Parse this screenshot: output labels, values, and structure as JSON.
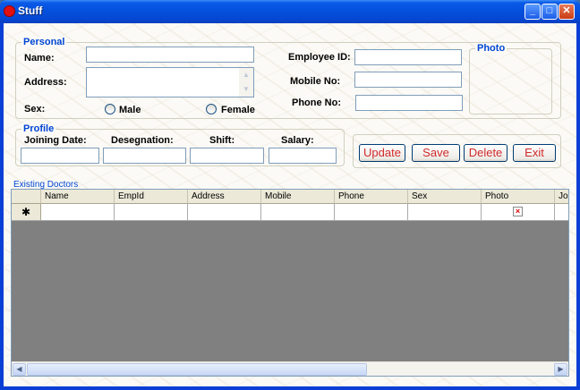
{
  "window": {
    "title": "Stuff",
    "buttons": {
      "minimize": "_",
      "maximize": "□",
      "close": "✕"
    }
  },
  "personal": {
    "group_title": "Personal",
    "name_label": "Name:",
    "name_value": "",
    "address_label": "Address:",
    "address_value": "",
    "sex_label": "Sex:",
    "male_label": "Male",
    "female_label": "Female",
    "employee_id_label": "Employee ID:",
    "employee_id_value": "",
    "mobile_label": "Mobile No:",
    "mobile_value": "",
    "phone_label": "Phone No:",
    "phone_value": ""
  },
  "photo": {
    "group_title": "Photo"
  },
  "profile": {
    "group_title": "Profile",
    "joining_date_label": "Joining Date:",
    "designation_label": "Desegnation:",
    "shift_label": "Shift:",
    "salary_label": "Salary:",
    "joining_date_value": "",
    "designation_value": "",
    "shift_value": "",
    "salary_value": ""
  },
  "actions": {
    "update": "Update",
    "save": "Save",
    "delete": "Delete",
    "exit": "Exit"
  },
  "grid": {
    "caption": "Existing Doctors",
    "columns": [
      "Name",
      "EmpId",
      "Address",
      "Mobile",
      "Phone",
      "Sex",
      "Photo",
      "Jo"
    ],
    "new_row_marker": "✱",
    "photo_placeholder": "×"
  },
  "colors": {
    "accent_blue": "#0046d5",
    "button_text": "#d02b2b",
    "grid_background": "#808080"
  }
}
